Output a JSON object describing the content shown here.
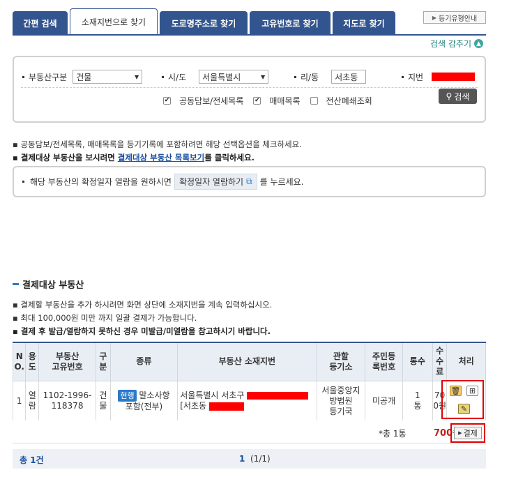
{
  "tabs": [
    "간편 검색",
    "소재지번으로 찾기",
    "도로명주소로 찾기",
    "고유번호로 찾기",
    "지도로 찾기"
  ],
  "guide_button": "등기유형안내",
  "hide_search": "검색 감추기",
  "search": {
    "type_label": "부동산구분",
    "type_value": "건물",
    "sido_label": "시/도",
    "sido_value": "서울특별시",
    "ri_label": "리/동",
    "ri_value": "서초동",
    "jibun_label": "지번",
    "checks": [
      "공동담보/전세목록",
      "매매목록",
      "전산폐쇄조회"
    ],
    "search_button": "검색"
  },
  "notes": {
    "line1": "공동담보/전세목록, 매매목록을 등기기록에 포함하려면 해당 선택옵션을 체크하세요.",
    "line2_pre": "결제대상 부동산을 보시려면 ",
    "line2_link": "결제대상 부동산 목록보기",
    "line2_post": "를 클릭하세요."
  },
  "info": {
    "pre": "해당 부동산의 확정일자 열람을 원하시면",
    "button": "확정일자 열람하기",
    "post": "를 누르세요."
  },
  "section_title": "결제대상 부동산",
  "notes2": {
    "line1": "결제할 부동산을 추가 하시려면 화면 상단에 소재지번을 계속 입력하십시오.",
    "line2": "최대 100,000원 미만 까지 일괄 결제가 가능합니다.",
    "line3": "결제 후 발급/열람하지 못하신 경우 미발급/미열람을 참고하시기 바랍니다."
  },
  "table": {
    "headers": [
      "N\nO.",
      "용\n도",
      "부동산\n고유번호",
      "구\n분",
      "종류",
      "부동산 소재지번",
      "관할\n등기소",
      "주민등\n록번호",
      "통수",
      "수\n수\n료",
      "처리"
    ],
    "row": {
      "no": "1",
      "use": "열람",
      "id": "1102-1996-118378",
      "kind": "건물",
      "type_badge": "현행",
      "type_text": "말소사항 포함(전부)",
      "address_line1": "서울특별시 서초구",
      "address_line2": "[서초동",
      "office": "서울중앙지방법원 등기국",
      "resident": "미공개",
      "copies": "1 통",
      "fee": "700원"
    }
  },
  "totals": {
    "label": "*총 1통",
    "amount": "700",
    "unit": "원",
    "pay_button": "결제"
  },
  "footer": {
    "count": "총 1건",
    "page_current": "1",
    "page_info": "(1/1)"
  }
}
